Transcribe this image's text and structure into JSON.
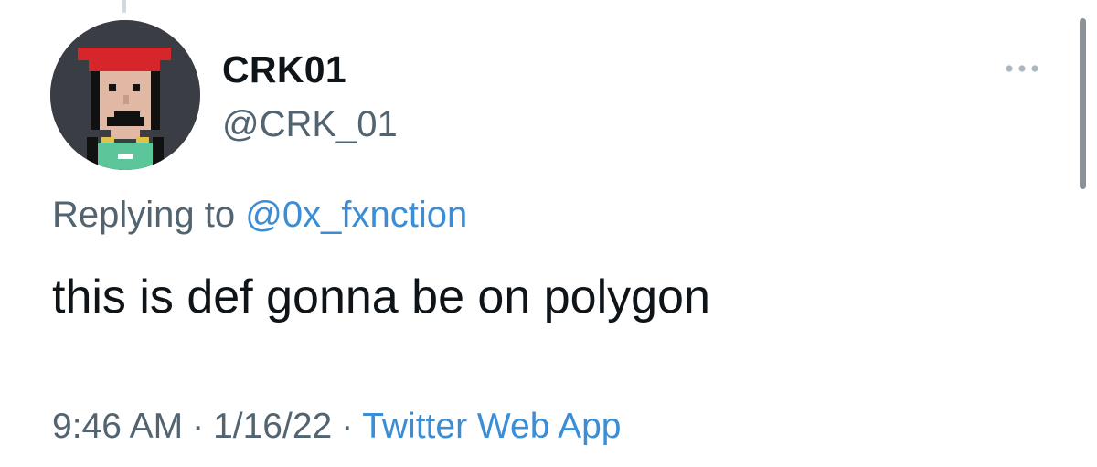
{
  "tweet": {
    "author": {
      "display_name": "CRK01",
      "handle": "@CRK_01",
      "avatar_icon": "pixel-punk-avatar"
    },
    "replying_to_label": "Replying to",
    "replying_to_handle": "@0x_fxnction",
    "text": "this is def gonna be on polygon",
    "time": "9:46 AM",
    "separator": "·",
    "date": "1/16/22",
    "source": "Twitter Web App"
  },
  "icons": {
    "more": "more-horizontal-icon"
  },
  "colors": {
    "text_primary": "#0f1419",
    "text_secondary": "#536471",
    "link": "#3b8ed6",
    "avatar_background": "#3a3d44",
    "avatar_hat": "#d7262b",
    "avatar_skin": "#e1b8a3",
    "avatar_shirt": "#5cc59a"
  }
}
